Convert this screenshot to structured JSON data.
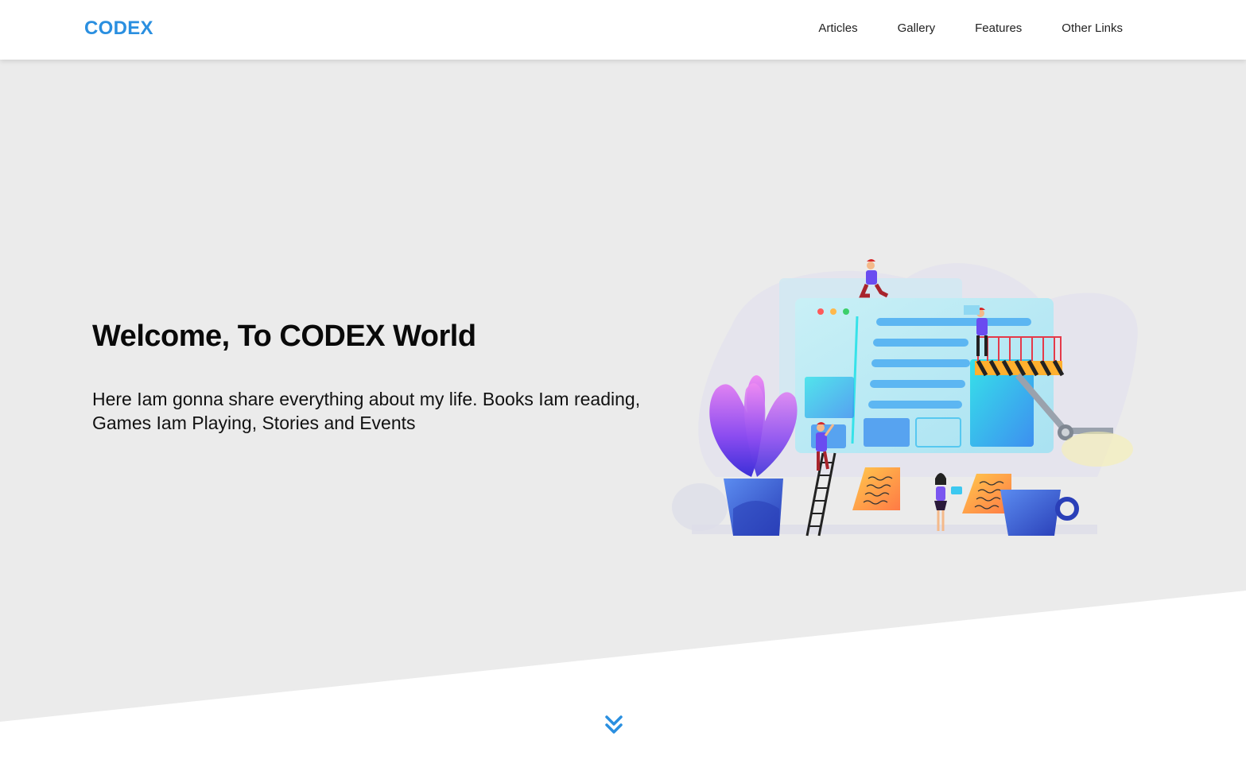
{
  "brand": {
    "name": "CODEX",
    "color": "#2a8fe0"
  },
  "nav": {
    "items": [
      {
        "label": "Articles"
      },
      {
        "label": "Gallery"
      },
      {
        "label": "Features"
      },
      {
        "label": "Other Links"
      }
    ]
  },
  "hero": {
    "title": "Welcome, To CODEX World",
    "text": "Here Iam gonna share everything about my life. Books Iam reading, Games Iam Playing, Stories and Events",
    "background": "#ebebeb",
    "illustration_icon": "web-development-illustration"
  },
  "scroll": {
    "icon": "double-chevron-down-icon",
    "color": "#2a8fe0"
  }
}
